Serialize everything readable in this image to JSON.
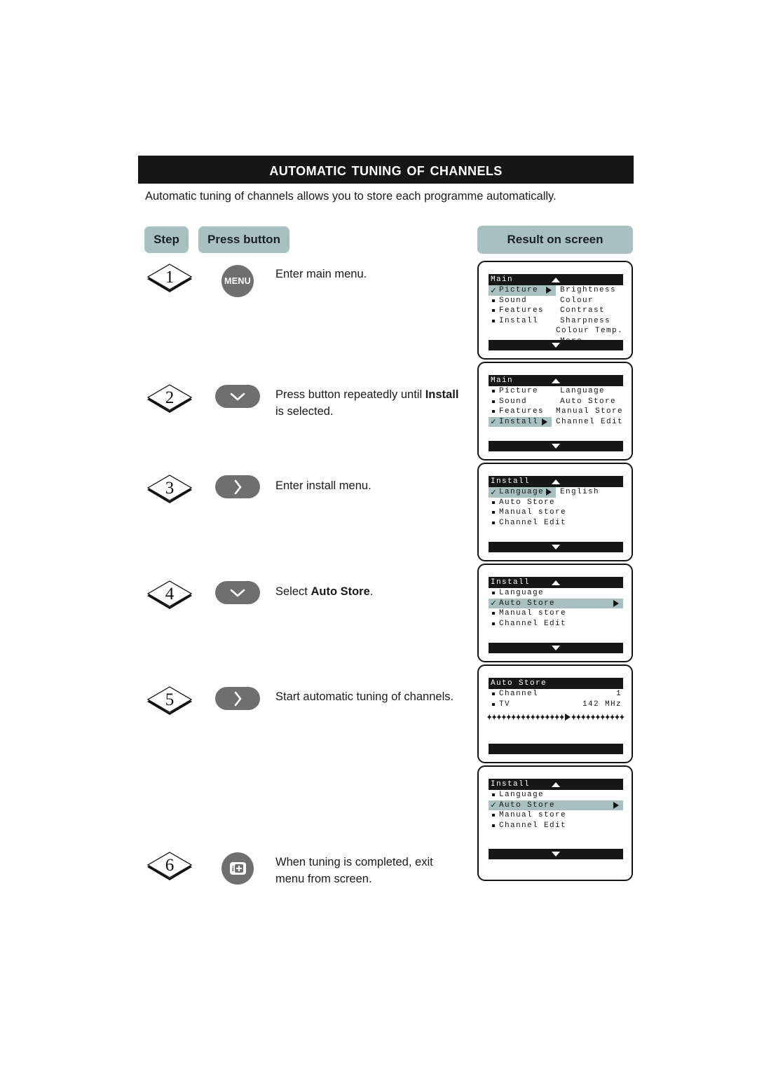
{
  "page": {
    "title": "Automatic Tuning of Channels",
    "intro": "Automatic tuning of channels allows you to store each programme automatically."
  },
  "headers": {
    "step": "Step",
    "press_button": "Press button",
    "result_on_screen": "Result on screen"
  },
  "colors": {
    "title_bar": "#161616",
    "pill": "#a9c0c0",
    "button": "#6f6f6f",
    "osd_highlight": "#a9c0c0",
    "osd_bar": "#161616"
  },
  "steps": [
    {
      "number": "1",
      "button": {
        "type": "label",
        "label": "MENU",
        "icon": "menu-button",
        "shape": "circle"
      },
      "text_plain": "Enter main menu.",
      "text_parts": [
        {
          "t": "Enter main menu.",
          "bold": false
        }
      ]
    },
    {
      "number": "2",
      "button": {
        "type": "icon",
        "label": "",
        "icon": "chevron-down-icon",
        "shape": "pad"
      },
      "text_plain": "Press button repeatedly until Install is selected.",
      "text_parts": [
        {
          "t": "Press button repeatedly until ",
          "bold": false
        },
        {
          "t": "Install",
          "bold": true
        },
        {
          "t": " is selected.",
          "bold": false
        }
      ]
    },
    {
      "number": "3",
      "button": {
        "type": "icon",
        "label": "",
        "icon": "chevron-right-icon",
        "shape": "pad"
      },
      "text_plain": "Enter install menu.",
      "text_parts": [
        {
          "t": "Enter install menu.",
          "bold": false
        }
      ]
    },
    {
      "number": "4",
      "button": {
        "type": "icon",
        "label": "",
        "icon": "chevron-down-icon",
        "shape": "pad"
      },
      "text_plain": "Select Auto Store.",
      "text_parts": [
        {
          "t": "Select ",
          "bold": false
        },
        {
          "t": "Auto Store",
          "bold": true
        },
        {
          "t": ".",
          "bold": false
        }
      ]
    },
    {
      "number": "5",
      "button": {
        "type": "icon",
        "label": "",
        "icon": "chevron-right-icon",
        "shape": "pad"
      },
      "text_plain": "Start automatic tuning of channels.",
      "text_parts": [
        {
          "t": "Start automatic tuning of channels.",
          "bold": false
        }
      ]
    },
    {
      "number": "6",
      "button": {
        "type": "icon",
        "label": "",
        "icon": "info-plus-icon",
        "shape": "circle"
      },
      "text_plain": "When tuning is completed, exit menu from screen.",
      "text_parts": [
        {
          "t": "When tuning is completed, exit menu from screen.",
          "bold": false
        }
      ]
    }
  ],
  "screens": [
    {
      "id": "screen-1-main-picture",
      "header": "Main",
      "header_arrow": "up-arrow",
      "rows": [
        {
          "bullet": "check",
          "label": "Picture",
          "highlight": true,
          "arrow": true,
          "right": "Brightness"
        },
        {
          "bullet": "square",
          "label": "Sound",
          "highlight": false,
          "arrow": false,
          "right": "Colour"
        },
        {
          "bullet": "square",
          "label": "Features",
          "highlight": false,
          "arrow": false,
          "right": "Contrast"
        },
        {
          "bullet": "square",
          "label": "Install",
          "highlight": false,
          "arrow": false,
          "right": "Sharpness"
        },
        {
          "bullet": "none",
          "label": "",
          "highlight": false,
          "arrow": false,
          "right": "Colour Temp."
        },
        {
          "bullet": "none",
          "label": "",
          "highlight": false,
          "arrow": false,
          "right": "More..."
        }
      ],
      "footer_arrow": "down-arrow",
      "has_footer_arrow": true,
      "progress": null
    },
    {
      "id": "screen-2-main-install",
      "header": "Main",
      "header_arrow": "up-arrow",
      "rows": [
        {
          "bullet": "square",
          "label": "Picture",
          "highlight": false,
          "arrow": false,
          "right": "Language"
        },
        {
          "bullet": "square",
          "label": "Sound",
          "highlight": false,
          "arrow": false,
          "right": "Auto Store"
        },
        {
          "bullet": "square",
          "label": "Features",
          "highlight": false,
          "arrow": false,
          "right": "Manual Store"
        },
        {
          "bullet": "check",
          "label": "Install",
          "highlight": true,
          "arrow": true,
          "right": "Channel Edit"
        }
      ],
      "footer_arrow": "down-arrow",
      "has_footer_arrow": true,
      "progress": null
    },
    {
      "id": "screen-3-install-language",
      "header": "Install",
      "header_arrow": "up-arrow",
      "rows": [
        {
          "bullet": "check",
          "label": "Language",
          "highlight": true,
          "arrow": true,
          "right": "English"
        },
        {
          "bullet": "square",
          "label": "Auto Store",
          "highlight": false,
          "arrow": false,
          "right": ""
        },
        {
          "bullet": "square",
          "label": "Manual store",
          "highlight": false,
          "arrow": false,
          "right": ""
        },
        {
          "bullet": "square",
          "label": "Channel Edit",
          "highlight": false,
          "arrow": false,
          "right": ""
        }
      ],
      "footer_arrow": "down-arrow",
      "has_footer_arrow": true,
      "progress": null
    },
    {
      "id": "screen-4-install-autostore",
      "header": "Install",
      "header_arrow": "up-arrow",
      "rows": [
        {
          "bullet": "square",
          "label": "Language",
          "highlight": false,
          "arrow": false,
          "right": ""
        },
        {
          "bullet": "check",
          "label": "Auto Store",
          "highlight": "wide",
          "arrow": true,
          "right": ""
        },
        {
          "bullet": "square",
          "label": "Manual store",
          "highlight": false,
          "arrow": false,
          "right": ""
        },
        {
          "bullet": "square",
          "label": "Channel Edit",
          "highlight": false,
          "arrow": false,
          "right": ""
        }
      ],
      "footer_arrow": "down-arrow",
      "has_footer_arrow": true,
      "progress": null
    },
    {
      "id": "screen-5-autostore-running",
      "header": "Auto Store",
      "header_arrow": "none",
      "rows": [
        {
          "bullet": "square",
          "label": "Channel",
          "highlight": false,
          "arrow": false,
          "right": "",
          "value_right": "1"
        },
        {
          "bullet": "square",
          "label": "TV",
          "highlight": false,
          "arrow": false,
          "right": "",
          "value_right": "142 MHz"
        }
      ],
      "footer_arrow": "none",
      "has_footer_arrow": false,
      "progress": {
        "markers_before": 16,
        "markers_after": 17,
        "pointer": true
      }
    },
    {
      "id": "screen-6-install-autostore-done",
      "header": "Install",
      "header_arrow": "up-arrow",
      "rows": [
        {
          "bullet": "square",
          "label": "Language",
          "highlight": false,
          "arrow": false,
          "right": ""
        },
        {
          "bullet": "check",
          "label": "Auto Store",
          "highlight": "wide",
          "arrow": true,
          "right": ""
        },
        {
          "bullet": "square",
          "label": "Manual store",
          "highlight": false,
          "arrow": false,
          "right": ""
        },
        {
          "bullet": "square",
          "label": "Channel Edit",
          "highlight": false,
          "arrow": false,
          "right": ""
        }
      ],
      "footer_arrow": "down-arrow",
      "has_footer_arrow": true,
      "progress": null
    }
  ]
}
